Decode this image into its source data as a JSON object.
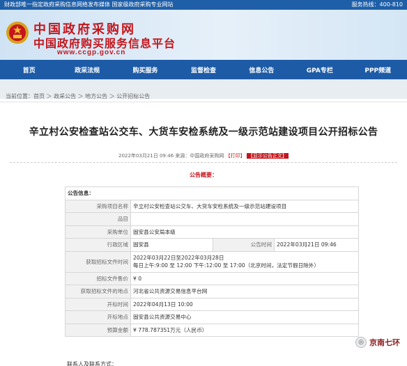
{
  "topbar": {
    "left_text": "财政部唯一指定政府采购信息网络发布媒体  国家级政府采购专业网站",
    "right_text": "服务热线：400-810"
  },
  "banner": {
    "title_line1": "中国政府采购网",
    "title_line2": "中国政府购买服务信息平台",
    "url": "www.ccgp.gov.cn"
  },
  "nav": {
    "items": [
      "首页",
      "政采法规",
      "购买服务",
      "监督检查",
      "信息公告",
      "GPA专栏",
      "PPP频道"
    ]
  },
  "breadcrumb": "当前位置：首页 ＞ 政采公告 ＞ 地方公告 ＞ 公开招标公告",
  "article": {
    "title": "辛立村公安检查站公交车、大货车安检系统及一级示范站建设项目公开招标公告",
    "meta_date": "2022年03月21日 09:46",
    "meta_source": "来源：中国政府采购网",
    "meta_print": "【打印】",
    "meta_show": "【显示公告正文】",
    "summary_label": "公告概要："
  },
  "info_table": {
    "section_title": "公告信息：",
    "rows": [
      {
        "label": "采购项目名称",
        "value": "辛立村公安检查站公交车、大货车安检系统及一级示范站建设项目"
      },
      {
        "label": "品目",
        "value": ""
      },
      {
        "label": "采购单位",
        "value": "固安县公安局本级"
      },
      {
        "label": "行政区域",
        "value": "固安县",
        "label2": "公告时间",
        "value2": "2022年03月21日 09:46"
      },
      {
        "label": "获取招标文件时间",
        "value": "2022年03月22日至2022年03月28日",
        "value_line2": "每日上午:9:00 至 12:00  下午:12:00 至 17:00（北京时间，法定节假日除外）"
      },
      {
        "label": "招标文件售价",
        "value": "¥ 0"
      },
      {
        "label": "获取招标文件的地点",
        "value": "河北省公共资源交易信息平台网"
      },
      {
        "label": "开标时间",
        "value": "2022年04月13日 10:00"
      },
      {
        "label": "开标地点",
        "value": "固安县公共资源交易中心"
      },
      {
        "label": "预算金额",
        "value": "¥ 778.787351万元（人民币）"
      }
    ]
  },
  "watermark": "京南七环",
  "cut_text": "联系人及联系方式："
}
